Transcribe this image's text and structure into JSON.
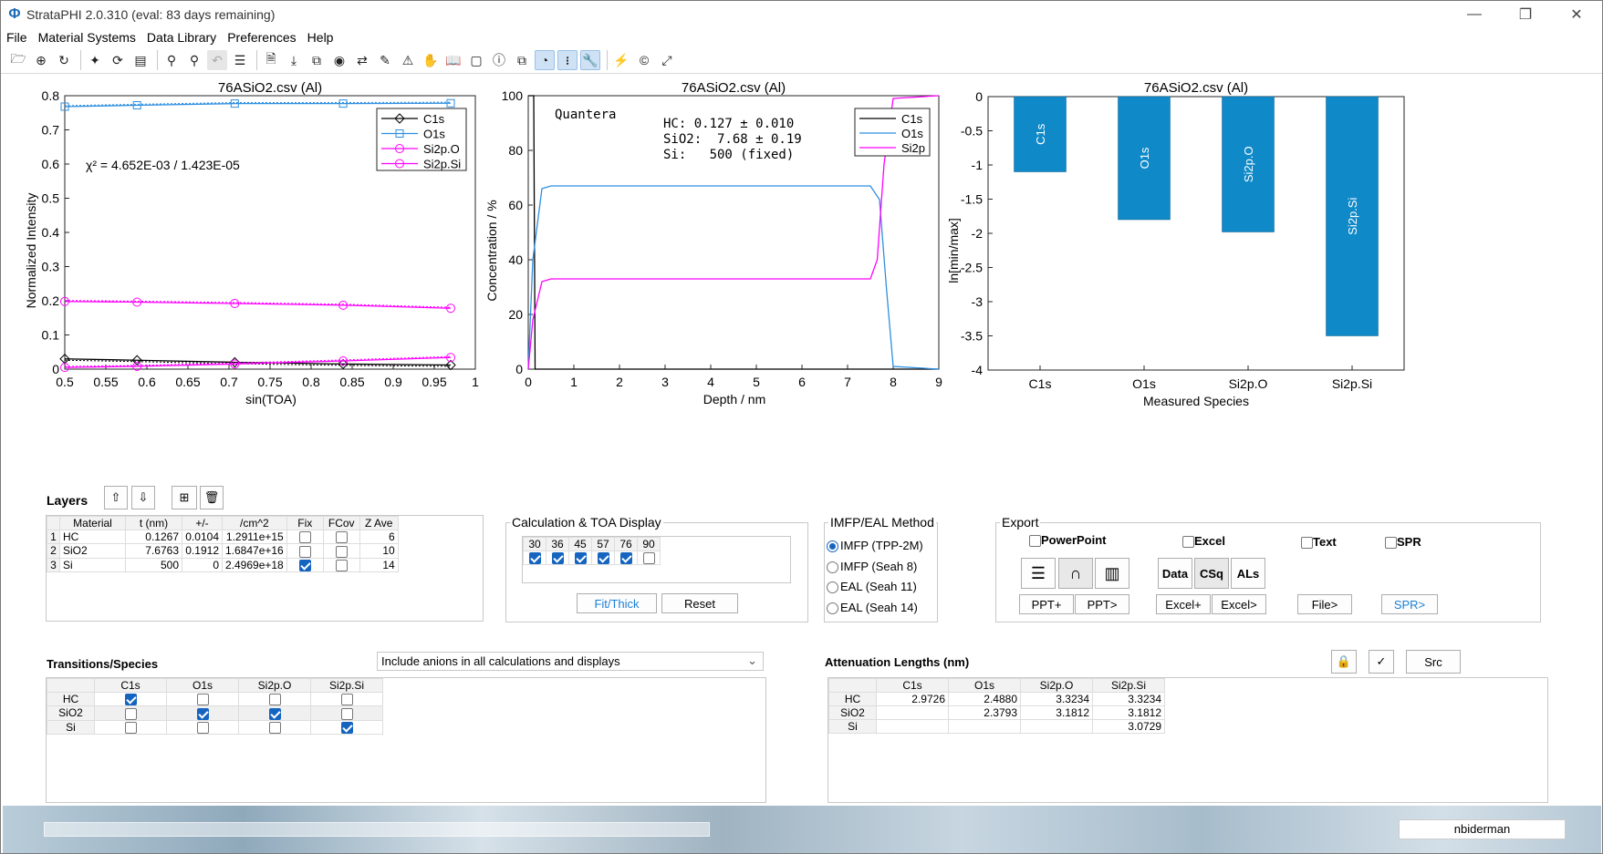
{
  "window": {
    "title": "StrataPHI 2.0.310 (eval: 83 days remaining)",
    "logo": "Φ"
  },
  "menu": [
    "File",
    "Material Systems",
    "Data Library",
    "Preferences",
    "Help"
  ],
  "plot1": {
    "title": "76ASiO2.csv (Al)",
    "xlabel": "sin(TOA)",
    "ylabel": "Normalized Intensity",
    "chi": "χ² = 4.652E-03 / 1.423E-05",
    "legend": [
      "C1s",
      "O1s",
      "Si2p.O",
      "Si2p.Si"
    ],
    "xticks": [
      "0.5",
      "0.55",
      "0.6",
      "0.65",
      "0.7",
      "0.75",
      "0.8",
      "0.85",
      "0.9",
      "0.95",
      "1"
    ],
    "yticks": [
      "0",
      "0.1",
      "0.2",
      "0.3",
      "0.4",
      "0.5",
      "0.6",
      "0.7",
      "0.8"
    ]
  },
  "plot2": {
    "title": "76ASiO2.csv (Al)",
    "xlabel": "Depth / nm",
    "ylabel": "Concentration / %",
    "instrument": "Quantera",
    "lines": [
      "HC: 0.127 ± 0.010",
      "SiO2:  7.68 ± 0.19",
      "Si:   500 (fixed)"
    ],
    "legend": [
      "C1s",
      "O1s",
      "Si2p"
    ],
    "xticks": [
      "0",
      "1",
      "2",
      "3",
      "4",
      "5",
      "6",
      "7",
      "8",
      "9"
    ],
    "yticks": [
      "0",
      "20",
      "40",
      "60",
      "80",
      "100"
    ]
  },
  "plot3": {
    "title": "76ASiO2.csv (Al)",
    "xlabel": "Measured Species",
    "ylabel": "ln[min/max]",
    "categories": [
      "C1s",
      "O1s",
      "Si2p.O",
      "Si2p.Si"
    ],
    "yticks": [
      "0",
      "-0.5",
      "-1",
      "-1.5",
      "-2",
      "-2.5",
      "-3",
      "-3.5",
      "-4"
    ]
  },
  "chart_data": [
    {
      "type": "line",
      "title": "76ASiO2.csv (Al)",
      "xlabel": "sin(TOA)",
      "ylabel": "Normalized Intensity",
      "xlim": [
        0.5,
        1
      ],
      "ylim": [
        0,
        0.8
      ],
      "x": [
        0.5,
        0.588,
        0.707,
        0.839,
        0.97
      ],
      "series": [
        {
          "name": "C1s",
          "values": [
            0.03,
            0.026,
            0.02,
            0.015,
            0.012
          ],
          "color": "#000000"
        },
        {
          "name": "O1s",
          "values": [
            0.768,
            0.772,
            0.777,
            0.777,
            0.778
          ],
          "color": "#2e8fe0"
        },
        {
          "name": "Si2p.O",
          "values": [
            0.198,
            0.196,
            0.192,
            0.187,
            0.178
          ],
          "color": "#ff00ff"
        },
        {
          "name": "Si2p.Si",
          "values": [
            0.005,
            0.008,
            0.015,
            0.024,
            0.034
          ],
          "color": "#ff00ff"
        }
      ],
      "legend": "top-right"
    },
    {
      "type": "line",
      "title": "76ASiO2.csv (Al)",
      "xlabel": "Depth / nm",
      "ylabel": "Concentration / %",
      "xlim": [
        0,
        9
      ],
      "ylim": [
        0,
        100
      ],
      "series": [
        {
          "name": "C1s",
          "color": "#000000",
          "points": [
            [
              0,
              100
            ],
            [
              0.12,
              100
            ],
            [
              0.15,
              0
            ],
            [
              9,
              0
            ]
          ]
        },
        {
          "name": "O1s",
          "color": "#2e8fe0",
          "points": [
            [
              0,
              0
            ],
            [
              0.1,
              40
            ],
            [
              0.3,
              66
            ],
            [
              0.5,
              67
            ],
            [
              7.5,
              67
            ],
            [
              7.7,
              62
            ],
            [
              7.85,
              30
            ],
            [
              8.0,
              1
            ],
            [
              9,
              0
            ]
          ]
        },
        {
          "name": "Si2p",
          "color": "#ff00ff",
          "points": [
            [
              0,
              0
            ],
            [
              0.1,
              18
            ],
            [
              0.3,
              32
            ],
            [
              0.5,
              33
            ],
            [
              7.5,
              33
            ],
            [
              7.65,
              40
            ],
            [
              7.8,
              75
            ],
            [
              8.0,
              99
            ],
            [
              9,
              100
            ]
          ]
        }
      ],
      "legend": "top-right"
    },
    {
      "type": "bar",
      "title": "76ASiO2.csv (Al)",
      "xlabel": "Measured Species",
      "ylabel": "ln[min/max]",
      "categories": [
        "C1s",
        "O1s",
        "Si2p.O",
        "Si2p.Si"
      ],
      "values": [
        -1.1,
        -1.8,
        -1.98,
        -3.5
      ],
      "ylim": [
        -4,
        0
      ],
      "color": "#0f89c8"
    }
  ],
  "layers": {
    "title": "Layers",
    "columns": [
      "",
      "Material",
      "t (nm)",
      "+/-",
      "/cm^2",
      "Fix",
      "FCov",
      "Z Ave"
    ],
    "rows": [
      {
        "n": "1",
        "m": "HC",
        "t": "0.1267",
        "e": "0.0104",
        "c": "1.2911e+15",
        "fix": false,
        "fcov": false,
        "z": "6"
      },
      {
        "n": "2",
        "m": "SiO2",
        "t": "7.6763",
        "e": "0.1912",
        "c": "1.6847e+16",
        "fix": false,
        "fcov": false,
        "z": "10"
      },
      {
        "n": "3",
        "m": "Si",
        "t": "500",
        "e": "0",
        "c": "2.4969e+18",
        "fix": true,
        "fcov": false,
        "z": "14"
      }
    ]
  },
  "calc": {
    "title": "Calculation & TOA Display",
    "angles": [
      "30",
      "36",
      "45",
      "57",
      "76",
      "90"
    ],
    "checked": [
      true,
      true,
      true,
      true,
      true,
      false
    ],
    "fit": "Fit/Thick",
    "reset": "Reset"
  },
  "imfp": {
    "title": "IMFP/EAL Method",
    "options": [
      "IMFP (TPP-2M)",
      "IMFP (Seah 8)",
      "EAL (Seah 11)",
      "EAL (Seah 14)"
    ],
    "selected": 0
  },
  "export": {
    "title": "Export",
    "powerpoint": "PowerPoint",
    "excel": "Excel",
    "text": "Text",
    "spr": "SPR",
    "data": "Data",
    "csq": "CSq",
    "als": "ALs",
    "pptplus": "PPT+",
    "pptgt": "PPT>",
    "excelplus": "Excel+",
    "excelgt": "Excel>",
    "filegt": "File>",
    "sprgt": "SPR>"
  },
  "transitions": {
    "title": "Transitions/Species",
    "dropdown": "Include anions in all calculations and displays",
    "columns": [
      "C1s",
      "O1s",
      "Si2p.O",
      "Si2p.Si"
    ],
    "rows": [
      {
        "name": "HC",
        "v": [
          true,
          false,
          false,
          false
        ]
      },
      {
        "name": "SiO2",
        "v": [
          false,
          true,
          true,
          false
        ]
      },
      {
        "name": "Si",
        "v": [
          false,
          false,
          false,
          true
        ]
      }
    ]
  },
  "atten": {
    "title": "Attenuation Lengths (nm)",
    "src": "Src",
    "columns": [
      "C1s",
      "O1s",
      "Si2p.O",
      "Si2p.Si"
    ],
    "rows": [
      {
        "name": "HC",
        "v": [
          "2.9726",
          "2.4880",
          "3.3234",
          "3.3234"
        ]
      },
      {
        "name": "SiO2",
        "v": [
          "",
          "2.3793",
          "3.1812",
          "3.1812"
        ]
      },
      {
        "name": "Si",
        "v": [
          "",
          "",
          "",
          "3.0729"
        ]
      }
    ]
  },
  "status": {
    "user": "nbiderman"
  }
}
